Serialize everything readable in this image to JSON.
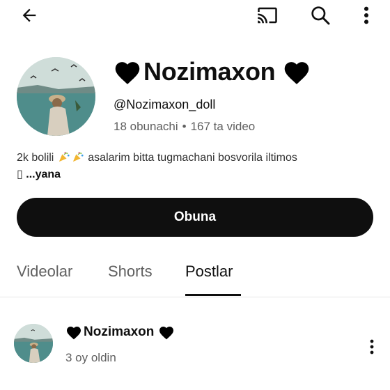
{
  "topbar": {
    "icons": [
      "back-arrow-icon",
      "cast-icon",
      "search-icon",
      "more-vert-icon"
    ]
  },
  "channel": {
    "name": "Nozimaxon",
    "handle": "@Nozimaxon_doll",
    "subscribers": "18 obunachi",
    "separator": "•",
    "videos": "167 ta video",
    "description_start": "2k bolili",
    "description_end": "asalarim bitta tugmachani bosvorila iltimos",
    "description_missing_glyph": "▯",
    "more_label": "...yana"
  },
  "subscribe": {
    "label": "Obuna"
  },
  "tabs": [
    {
      "label": "Videolar",
      "active": false
    },
    {
      "label": "Shorts",
      "active": false
    },
    {
      "label": "Postlar",
      "active": true
    }
  ],
  "post": {
    "author": "Nozimaxon",
    "time": "3 oy oldin"
  },
  "colors": {
    "primary": "#0f0f0f",
    "secondary": "#606060",
    "background": "#ffffff"
  }
}
